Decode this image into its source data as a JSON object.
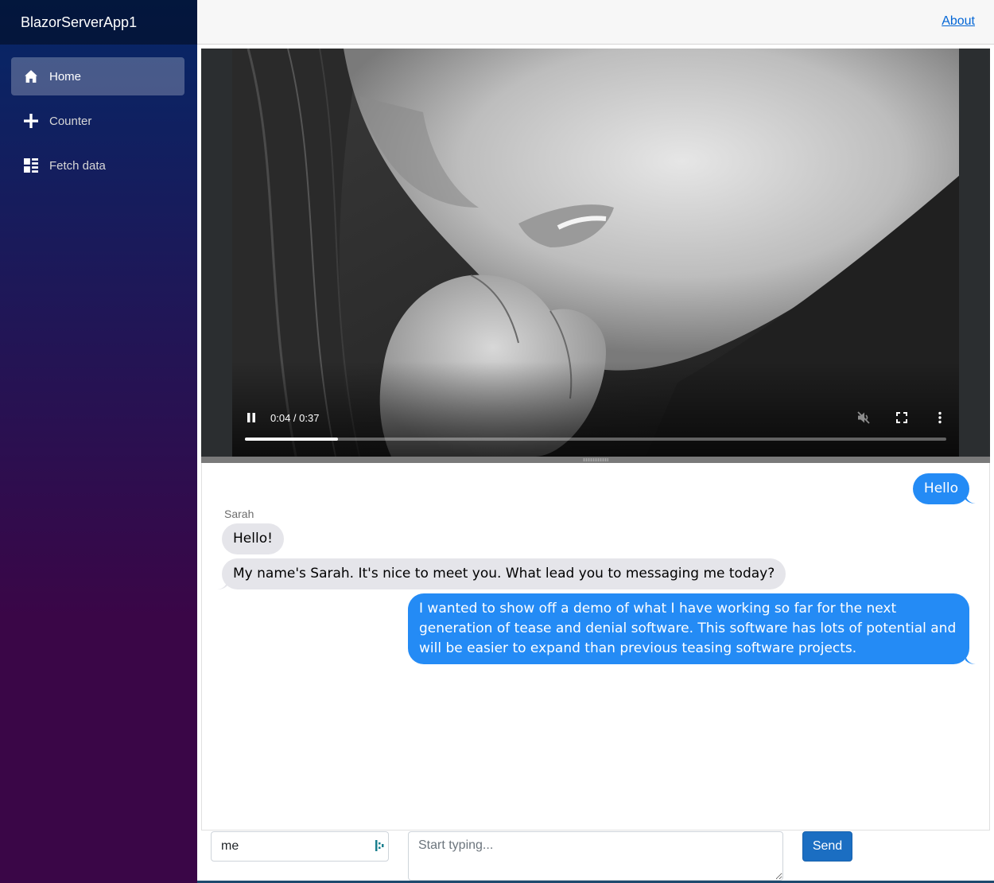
{
  "app": {
    "brand": "BlazorServerApp1"
  },
  "sidebar": {
    "items": [
      {
        "label": "Home",
        "icon": "home-icon",
        "active": true
      },
      {
        "label": "Counter",
        "icon": "plus-icon",
        "active": false
      },
      {
        "label": "Fetch data",
        "icon": "list-icon",
        "active": false
      }
    ]
  },
  "topbar": {
    "about_label": "About"
  },
  "video": {
    "time": "0:04 / 0:37",
    "progress": 0.133,
    "muted": true
  },
  "chat": {
    "messages": [
      {
        "from": "me",
        "text": "Hello"
      },
      {
        "from": "Sarah",
        "text": "Hello!"
      },
      {
        "from": "Sarah",
        "text": "My name's Sarah. It's nice to meet you. What lead you to messaging me today?"
      },
      {
        "from": "me",
        "text": "I wanted to show off a demo of what I have working so far for the next generation of tease and denial software. This software has lots of potential and will be easier to expand than previous teasing software projects."
      }
    ],
    "sender_label": "Sarah"
  },
  "composer": {
    "sender_value": "me",
    "placeholder": "Start typing...",
    "send_label": "Send"
  },
  "colors": {
    "sidebar_top": "#052767",
    "sidebar_bottom": "#3a0647",
    "bubble_me": "#248bf5",
    "bubble_them": "#e5e5ea",
    "send_button": "#1b6ec2",
    "link": "#0366d6"
  }
}
